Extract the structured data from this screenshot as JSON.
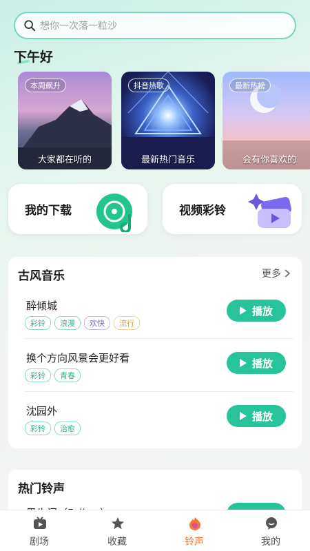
{
  "search": {
    "placeholder": "想你一次落一粒沙"
  },
  "greeting": "下午好",
  "banners": [
    {
      "tag": "本周飙升",
      "caption": "大家都在听的"
    },
    {
      "tag": "抖音热歌",
      "caption": "最新热门音乐"
    },
    {
      "tag": "最新热榜",
      "caption": "会有你喜欢的"
    }
  ],
  "quick": {
    "download": "我的下载",
    "video_ringtone": "视频彩铃"
  },
  "section1": {
    "title": "古风音乐",
    "more": "更多",
    "songs": [
      {
        "name": "醉倾城",
        "tags": [
          "彩铃",
          "浪漫",
          "欢快",
          "流行"
        ],
        "play": "播放"
      },
      {
        "name": "换个方向风景会更好看",
        "tags": [
          "彩铃",
          "青春"
        ],
        "play": "播放"
      },
      {
        "name": "沈园外",
        "tags": [
          "彩铃",
          "治愈"
        ],
        "play": "播放"
      }
    ]
  },
  "section2": {
    "title": "热门铃声",
    "partial_song": "黑牛门（Follow）"
  },
  "tabbar": {
    "items": [
      "剧场",
      "收藏",
      "铃声",
      "我的"
    ],
    "active": "铃声"
  },
  "colors": {
    "accent": "#27c39a",
    "active_tab": "#f07a2e"
  }
}
